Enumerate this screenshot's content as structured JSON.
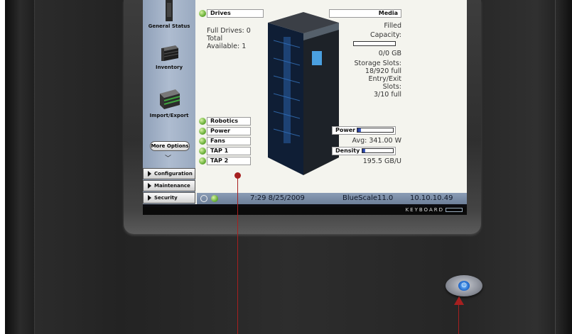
{
  "sidebar": {
    "items": [
      {
        "label": "General Status",
        "icon": "rack-icon"
      },
      {
        "label": "Inventory",
        "icon": "tape-stack-icon"
      },
      {
        "label": "Import/Export",
        "icon": "magazine-icon"
      }
    ],
    "more_options": "More Options",
    "nav_buttons": [
      {
        "label": "Configuration"
      },
      {
        "label": "Maintenance"
      },
      {
        "label": "Security"
      }
    ]
  },
  "drives": {
    "label": "Drives",
    "full_drives": "Full Drives: 0",
    "total": "Total",
    "available": "Available: 1"
  },
  "media": {
    "label": "Media",
    "filled": "Filled",
    "capacity": "Capacity:",
    "capacity_fill": 0.0,
    "capacity_value": "0/0 GB",
    "storage_slots": "Storage Slots:",
    "storage_value": "18/920 full",
    "entry_exit": "Entry/Exit",
    "slots": "Slots:",
    "slots_value": "3/10 full"
  },
  "components": [
    {
      "label": "Robotics"
    },
    {
      "label": "Power"
    },
    {
      "label": "Fans"
    },
    {
      "label": "TAP 1"
    },
    {
      "label": "TAP 2"
    }
  ],
  "power": {
    "label": "Power",
    "avg": "Avg: 341.00 W",
    "level": 0.1
  },
  "density": {
    "label": "Density",
    "value": "195.5 GB/U",
    "level": 0.1
  },
  "status_bar": {
    "time": "7:29 8/25/2009",
    "version": "BlueScale11.0",
    "ip": "10.10.10.49"
  },
  "keyboard_bar": {
    "label": "KEYBOARD"
  },
  "colors": {
    "accent": "#a62020",
    "status_ok": "#6bb13a",
    "sidebar": "#9aaac0"
  }
}
